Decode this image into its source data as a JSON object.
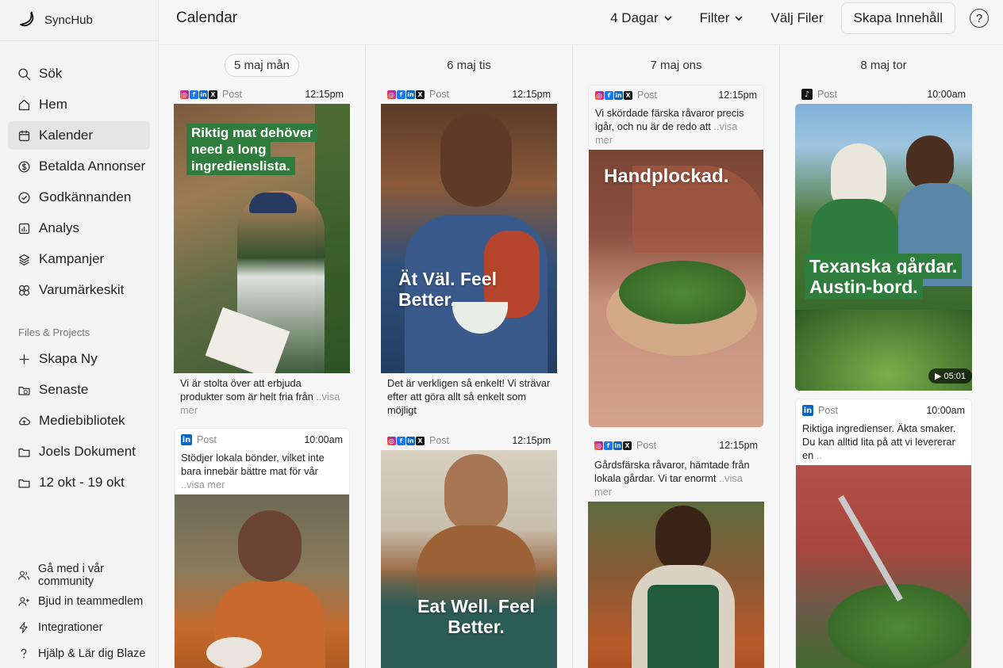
{
  "brand": {
    "name": "SyncHub"
  },
  "nav": [
    {
      "label": "Sök",
      "icon": "search-icon"
    },
    {
      "label": "Hem",
      "icon": "home-icon"
    },
    {
      "label": "Kalender",
      "icon": "calendar-icon",
      "active": true
    },
    {
      "label": "Betalda Annonser",
      "icon": "dollar-icon"
    },
    {
      "label": "Godkännanden",
      "icon": "check-circle-icon"
    },
    {
      "label": "Analys",
      "icon": "chart-icon"
    },
    {
      "label": "Kampanjer",
      "icon": "layers-icon"
    },
    {
      "label": "Varumärkeskit",
      "icon": "palette-icon"
    }
  ],
  "files_section": {
    "label": "Files & Projects",
    "items": [
      {
        "label": "Skapa Ny",
        "icon": "plus-icon"
      },
      {
        "label": "Senaste",
        "icon": "recent-folder-icon"
      },
      {
        "label": "Mediebibliotek",
        "icon": "cloud-icon"
      },
      {
        "label": "Joels Dokument",
        "icon": "folder-icon"
      },
      {
        "label": "12 okt - 19 okt",
        "icon": "folder-icon"
      }
    ]
  },
  "bottom_nav": [
    {
      "label": "Gå med i vår community",
      "icon": "users-icon"
    },
    {
      "label": "Bjud in teammedlem",
      "icon": "user-plus-icon"
    },
    {
      "label": "Integrationer",
      "icon": "bolt-icon"
    },
    {
      "label": "Hjälp & Lär dig Blaze",
      "icon": "question-icon"
    }
  ],
  "header": {
    "title": "Calendar",
    "view_label": "4 Dagar",
    "filter_label": "Filter",
    "files_label": "Välj Filer",
    "create_label": "Skapa Innehåll",
    "help": "?"
  },
  "days": [
    {
      "label": "5 maj mån",
      "selected": true,
      "posts": [
        {
          "platforms": [
            "ig",
            "fb",
            "li",
            "x"
          ],
          "type": "Post",
          "time": "12:15pm",
          "overlay": "Riktig mat dehöver need a long ingredienslista.",
          "caption": "Vi är stolta över att erbjuda produkter som är helt fria från",
          "more": "..visa mer"
        },
        {
          "platforms": [
            "li"
          ],
          "type": "Post",
          "time": "10:00am",
          "caption": "Stödjer lokala bönder, vilket inte bara innebär bättre mat för vår",
          "more": "..visa mer"
        }
      ]
    },
    {
      "label": "6 maj tis",
      "posts": [
        {
          "platforms": [
            "ig",
            "fb",
            "li",
            "x"
          ],
          "type": "Post",
          "time": "12:15pm",
          "overlay": "Ät Väl. Feel Better.",
          "caption": "Det är verkligen så enkelt! Vi strävar efter att göra allt så enkelt som möjligt"
        },
        {
          "platforms": [
            "ig",
            "fb",
            "li",
            "x"
          ],
          "type": "Post",
          "time": "12:15pm",
          "overlay": "Eat Well. Feel Better."
        }
      ]
    },
    {
      "label": "7 maj ons",
      "posts": [
        {
          "platforms": [
            "ig",
            "fb",
            "li",
            "x"
          ],
          "type": "Post",
          "time": "12:15pm",
          "caption": "Vi skördade färska råvaror precis igår, och nu är de redo att",
          "more": "..visa mer",
          "overlay": "Handplockad."
        },
        {
          "platforms": [
            "ig",
            "fb",
            "li",
            "x"
          ],
          "type": "Post",
          "time": "12:15pm",
          "caption": "Gårdsfärska råvaror, hämtade från lokala gårdar. Vi tar enormt",
          "more": "..visa mer"
        }
      ]
    },
    {
      "label": "8 maj tor",
      "posts": [
        {
          "platforms": [
            "tt"
          ],
          "type": "Post",
          "time": "10:00am",
          "overlay": "Texanska gårdar. Austin-bord.",
          "duration": "05:01"
        },
        {
          "platforms": [
            "li"
          ],
          "type": "Post",
          "time": "10:00am",
          "caption": "Riktiga ingredienser. Äkta smaker. Du kan alltid lita på att vi levererar en",
          "more": ".."
        }
      ]
    }
  ]
}
